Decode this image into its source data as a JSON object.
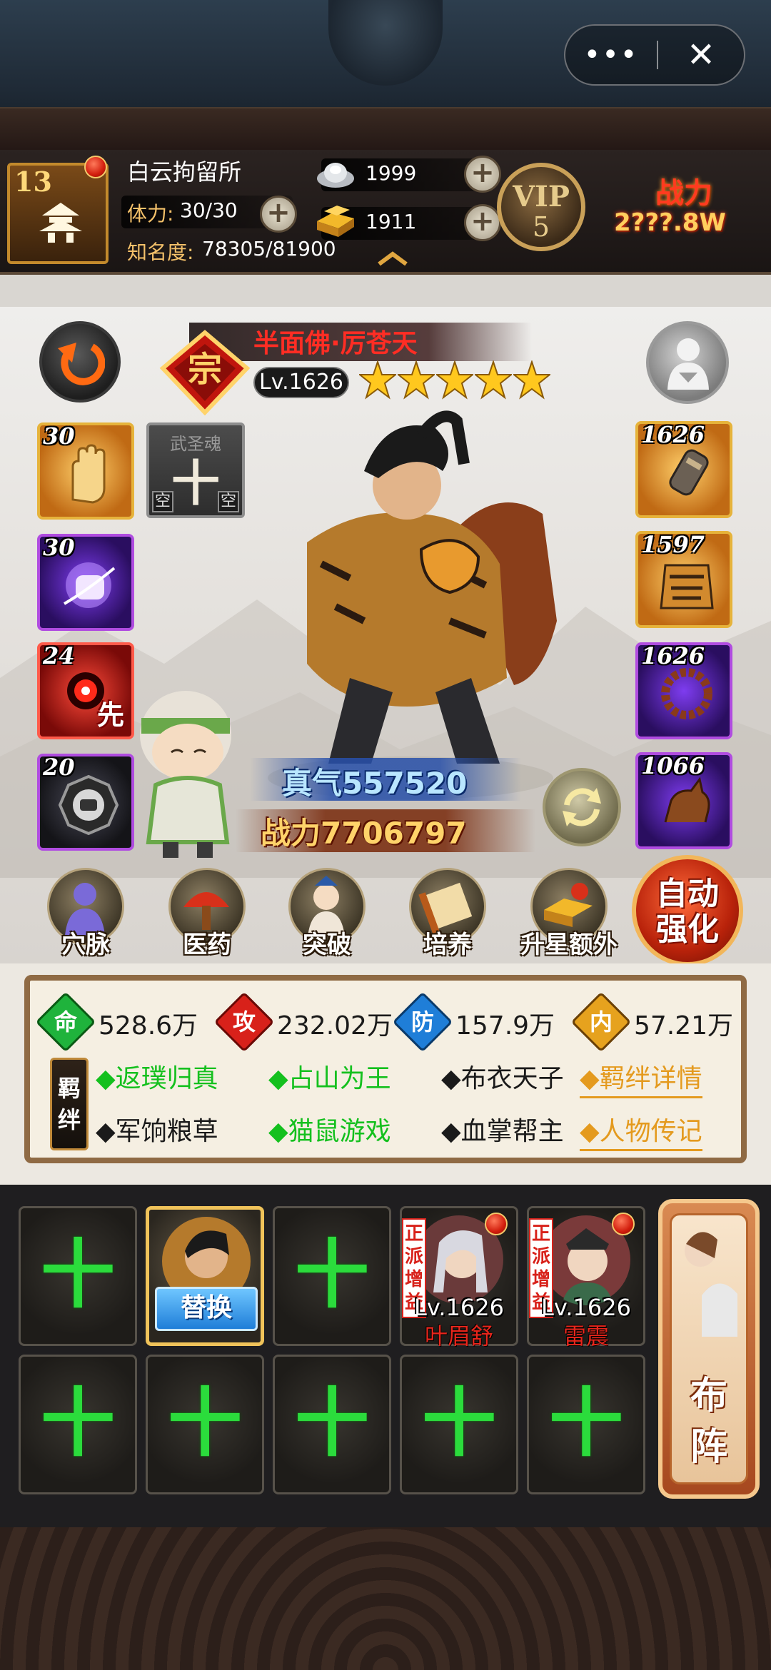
{
  "window": {
    "more_label": "•••",
    "close_label": "✕"
  },
  "prison": {
    "level": "13",
    "name": "白云拘留所"
  },
  "stamina": {
    "label": "体力:",
    "value": "30/30"
  },
  "fame": {
    "label": "知名度:",
    "value": "78305/81900"
  },
  "currency": {
    "silver": "1999",
    "gold": "1911"
  },
  "vip": {
    "label": "VIP",
    "level": "5"
  },
  "combat_power": {
    "label": "战力",
    "value": "2???.8W"
  },
  "hero": {
    "name": "半面佛·厉苍天",
    "grade": "宗",
    "level": "Lv.1626",
    "stars": 5,
    "qi": "真气557520",
    "power": "战力7706797"
  },
  "skills_left": [
    {
      "level": "30",
      "type": "gold"
    },
    {
      "level": "30",
      "type": "purple"
    },
    {
      "level": "24",
      "type": "red",
      "tag": "先"
    },
    {
      "level": "20",
      "type": "dark"
    }
  ],
  "soul": {
    "title": "武圣魂",
    "plus": "十",
    "empty_left": "空",
    "empty_right": "空"
  },
  "equipment_right": [
    {
      "level": "1626",
      "type": "gold"
    },
    {
      "level": "1597",
      "type": "gold"
    },
    {
      "level": "1626",
      "type": "purple"
    },
    {
      "level": "1066",
      "type": "purple"
    }
  ],
  "actions": [
    {
      "label": "穴脉",
      "icon": "meridian-icon"
    },
    {
      "label": "医药",
      "icon": "medicine-icon"
    },
    {
      "label": "突破",
      "icon": "breakthrough-icon"
    },
    {
      "label": "培养",
      "icon": "scroll-icon"
    },
    {
      "label": "升星额外",
      "icon": "gold-ingot-icon"
    }
  ],
  "auto_enhance": {
    "line1": "自动",
    "line2": "强化"
  },
  "stats": [
    {
      "char": "命",
      "value": "528.6万",
      "color": "#1fb33c"
    },
    {
      "char": "攻",
      "value": "232.02万",
      "color": "#d8211a"
    },
    {
      "char": "防",
      "value": "157.9万",
      "color": "#1f7ed8"
    },
    {
      "char": "内",
      "value": "57.21万",
      "color": "#e6a21e"
    }
  ],
  "bonds": {
    "tag_line1": "羁",
    "tag_line2": "绊",
    "items": [
      {
        "text": "◆返璞归真",
        "active": true
      },
      {
        "text": "◆占山为王",
        "active": true
      },
      {
        "text": "◆布衣天子",
        "active": false
      },
      {
        "text": "◆军饷粮草",
        "active": false
      },
      {
        "text": "◆猫鼠游戏",
        "active": true
      },
      {
        "text": "◆血掌帮主",
        "active": false
      }
    ],
    "detail_link": "◆羁绊详情",
    "bio_link": "◆人物传记"
  },
  "lineup": {
    "swap_label": "替换",
    "plus": "十",
    "tag_text": "正派增益",
    "members": [
      {
        "level": "Lv.1626",
        "name": "叶眉舒"
      },
      {
        "level": "Lv.1626",
        "name": "雷震"
      }
    ],
    "formation": {
      "line1": "布",
      "line2": "阵"
    }
  }
}
